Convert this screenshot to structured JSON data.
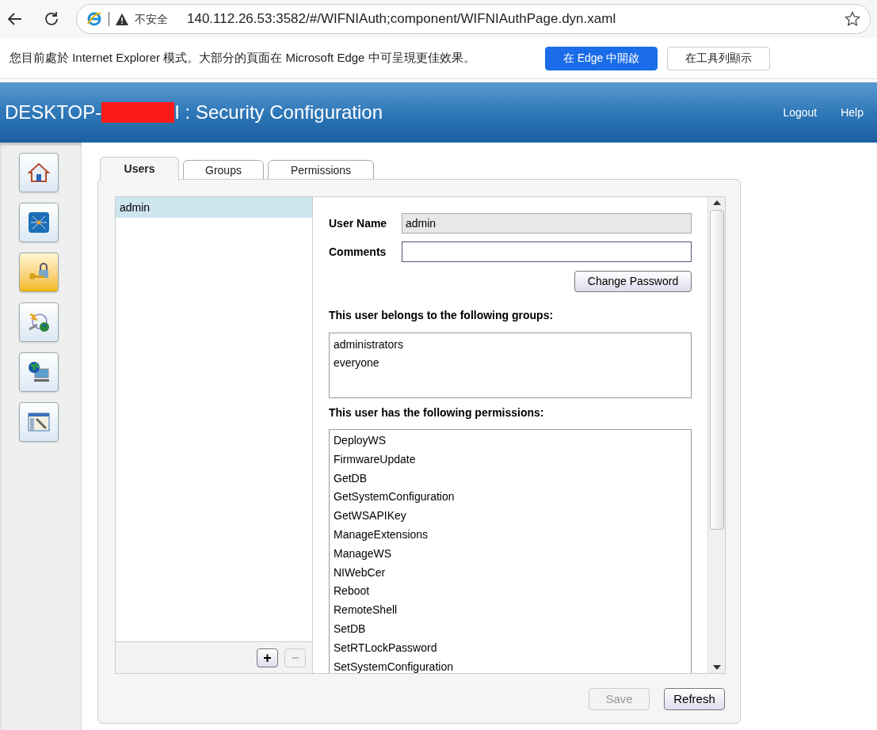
{
  "browser": {
    "security_label": "不安全",
    "url": "140.112.26.53:3582/#/WIFNIAuth;component/WIFNIAuthPage.dyn.xaml"
  },
  "ie_bar": {
    "message": "您目前處於 Internet Explorer 模式。大部分的頁面在 Microsoft Edge 中可呈現更佳效果。",
    "buttons": [
      {
        "label": "在 Edge 中開啟",
        "kind": "primary"
      },
      {
        "label": "在工具列顯示",
        "kind": "secondary"
      }
    ]
  },
  "header": {
    "title_prefix": "DESKTOP-",
    "title_suffix": "I : Security Configuration",
    "links": [
      "Logout",
      "Help"
    ]
  },
  "sidebar": {
    "items": [
      {
        "kind": "home",
        "selected": false
      },
      {
        "kind": "network",
        "selected": false
      },
      {
        "kind": "security",
        "selected": true
      },
      {
        "kind": "remote",
        "selected": false
      },
      {
        "kind": "computer",
        "selected": false
      },
      {
        "kind": "settings",
        "selected": false
      }
    ]
  },
  "tabs": [
    {
      "label": "Users",
      "selected": true
    },
    {
      "label": "Groups",
      "selected": false
    },
    {
      "label": "Permissions",
      "selected": false
    }
  ],
  "users": [
    {
      "name": "admin",
      "selected": true
    }
  ],
  "user_buttons": [
    {
      "label": "+",
      "disabled": false
    },
    {
      "label": "−",
      "disabled": true
    }
  ],
  "form": {
    "user_name_label": "User Name",
    "user_name": "admin",
    "comments_label": "Comments",
    "change_password": "Change Password",
    "groups_label": "This user belongs to the following groups:",
    "groups": [
      "administrators",
      "everyone"
    ],
    "permissions_label": "This user has the following permissions:",
    "permissions": [
      "DeployWS",
      "FirmwareUpdate",
      "GetDB",
      "GetSystemConfiguration",
      "GetWSAPIKey",
      "ManageExtensions",
      "ManageWS",
      "NIWebCer",
      "Reboot",
      "RemoteShell",
      "SetDB",
      "SetRTLockPassword",
      "SetSystemConfiguration"
    ]
  },
  "footer_buttons": [
    {
      "label": "Save",
      "disabled": true
    },
    {
      "label": "Refresh",
      "disabled": false
    }
  ]
}
